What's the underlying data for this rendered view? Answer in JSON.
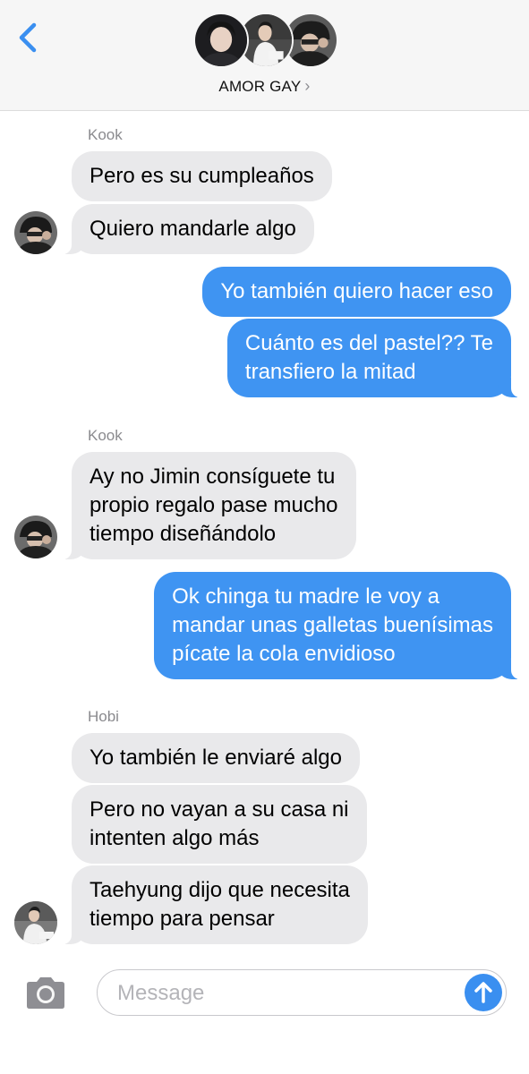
{
  "header": {
    "group_name": "AMOR GAY",
    "chevron": "›"
  },
  "messages": [
    {
      "sender": "Kook",
      "direction": "incoming",
      "text": "Pero es su cumpleaños"
    },
    {
      "direction": "incoming",
      "text": "Quiero mandarle algo"
    },
    {
      "direction": "outgoing",
      "text": "Yo también quiero hacer eso"
    },
    {
      "direction": "outgoing",
      "text": "Cuánto es del pastel?? Te\ntransfiero la mitad"
    },
    {
      "sender": "Kook",
      "direction": "incoming",
      "text": "Ay no Jimin consíguete tu\npropio regalo pase mucho\ntiempo diseñándolo"
    },
    {
      "direction": "outgoing",
      "text": "Ok chinga tu madre le voy a\nmandar unas galletas buenísimas\npícate la cola envidioso"
    },
    {
      "sender": "Hobi",
      "direction": "incoming",
      "text": "Yo también le enviaré algo"
    },
    {
      "direction": "incoming",
      "text": "Pero no vayan a su casa ni\nintenten algo más"
    },
    {
      "direction": "incoming",
      "text": "Taehyung dijo que necesita\ntiempo para pensar"
    }
  ],
  "composer": {
    "placeholder": "Message"
  },
  "icons": {
    "back": "chevron-left-icon",
    "camera": "camera-icon",
    "send": "arrow-up-icon"
  },
  "colors": {
    "accent": "#3f94f2",
    "incoming_bubble": "#e9e9eb",
    "header_bg": "#f6f6f6"
  }
}
